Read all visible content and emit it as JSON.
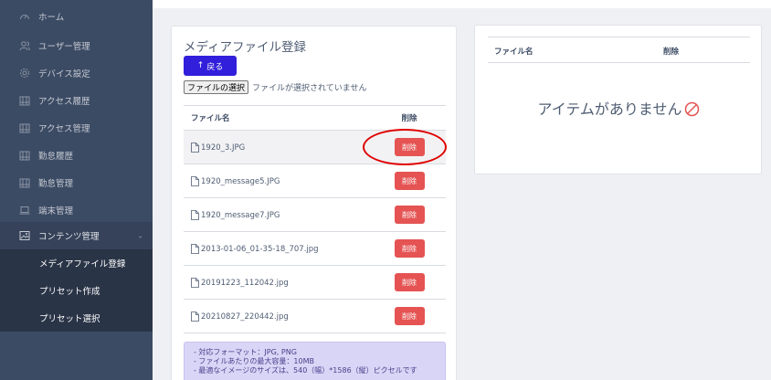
{
  "sidebar": {
    "items": [
      {
        "label": "ホーム",
        "icon": "speedometer-icon"
      },
      {
        "label": "ユーザー管理",
        "icon": "people-icon"
      },
      {
        "label": "デバイス設定",
        "icon": "settings-icon"
      },
      {
        "label": "アクセス履歴",
        "icon": "calendar-icon"
      },
      {
        "label": "アクセス管理",
        "icon": "calendar-icon"
      },
      {
        "label": "勤怠履歴",
        "icon": "calendar-icon"
      },
      {
        "label": "勤怠管理",
        "icon": "calendar-icon"
      },
      {
        "label": "端末管理",
        "icon": "laptop-icon"
      },
      {
        "label": "コンテンツ管理",
        "icon": "image-icon"
      }
    ],
    "sub_items": [
      {
        "label": "メディアファイル登録"
      },
      {
        "label": "プリセット作成"
      },
      {
        "label": "プリセット選択"
      }
    ]
  },
  "upload_card": {
    "title": "メディアファイル登録",
    "back_label": "戻る",
    "file_button_label": "ファイルの選択",
    "file_status": "ファイルが選択されていません",
    "table": {
      "headers": [
        "ファイル名",
        "削除"
      ],
      "rows": [
        {
          "name": "1920_3.JPG",
          "delete_label": "削除"
        },
        {
          "name": "1920_message5.JPG",
          "delete_label": "削除"
        },
        {
          "name": "1920_message7.JPG",
          "delete_label": "削除"
        },
        {
          "name": "2013-01-06_01-35-18_707.jpg",
          "delete_label": "削除"
        },
        {
          "name": "20191223_112042.jpg",
          "delete_label": "削除"
        },
        {
          "name": "20210827_220442.jpg",
          "delete_label": "削除"
        }
      ]
    },
    "info_lines": [
      "- 対応フォーマット：JPG, PNG",
      "- ファイルあたりの最大容量：10MB",
      "- 最適なイメージのサイズは、540（幅）*1586（縦）ピクセルです"
    ]
  },
  "preset_card": {
    "headers": [
      "ファイル名",
      "削除"
    ],
    "empty_message": "アイテムがありません"
  },
  "colors": {
    "sidebar_bg": "#3c4b64",
    "primary": "#321fdb",
    "danger": "#e55353",
    "highlight_circle": "#e00000"
  }
}
